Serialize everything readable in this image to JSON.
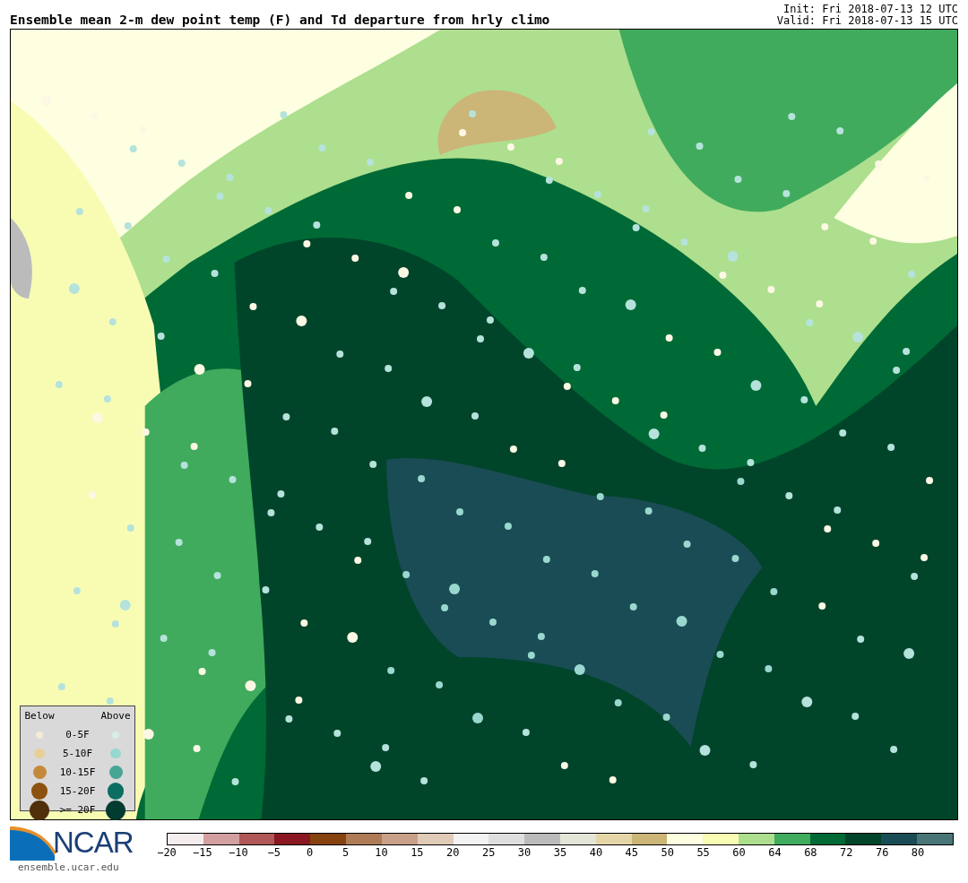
{
  "header": {
    "title": "Ensemble mean 2-m dew point temp (F) and Td departure from hrly climo",
    "init": "Init: Fri 2018-07-13 12 UTC",
    "valid": "Valid: Fri 2018-07-13 15 UTC"
  },
  "legend": {
    "below_heading": "Below",
    "above_heading": "Above",
    "rows": [
      {
        "label": "0-5F",
        "below": {
          "color": "#f3ead8"
        },
        "above": {
          "color": "#d8ecea"
        }
      },
      {
        "label": "5-10F",
        "below": {
          "color": "#e8cf96"
        },
        "above": {
          "color": "#96d8d0"
        }
      },
      {
        "label": "10-15F",
        "below": {
          "color": "#c48a3c"
        },
        "above": {
          "color": "#47a596"
        }
      },
      {
        "label": "15-20F",
        "below": {
          "color": "#8d520f"
        },
        "above": {
          "color": "#0b6e62"
        }
      },
      {
        "label": ">= 20F",
        "below": {
          "color": "#50300a"
        },
        "above": {
          "color": "#023b30"
        }
      }
    ]
  },
  "logo": {
    "name": "NCAR",
    "url": "ensemble.ucar.edu"
  },
  "colorbar": {
    "segments": [
      {
        "color": "#f5eded"
      },
      {
        "color": "#d49fa0"
      },
      {
        "color": "#af5857"
      },
      {
        "color": "#8b1720"
      },
      {
        "color": "#86420f"
      },
      {
        "color": "#ae7b56"
      },
      {
        "color": "#c8a088"
      },
      {
        "color": "#e0cab8"
      },
      {
        "color": "#f2f2f2"
      },
      {
        "color": "#dedede"
      },
      {
        "color": "#bbbbbb"
      },
      {
        "color": "#e3e5d6"
      },
      {
        "color": "#e5d6a8"
      },
      {
        "color": "#cbb577"
      },
      {
        "color": "#fefee0"
      },
      {
        "color": "#f8fcb3"
      },
      {
        "color": "#addf8e"
      },
      {
        "color": "#41ab5d"
      },
      {
        "color": "#006a36"
      },
      {
        "color": "#00452a"
      },
      {
        "color": "#1a4c55"
      },
      {
        "color": "#4a7577"
      }
    ],
    "ticks": [
      "−20",
      "−15",
      "−10",
      "−5",
      "0",
      "5",
      "10",
      "15",
      "20",
      "25",
      "30",
      "35",
      "40",
      "45",
      "50",
      "55",
      "60",
      "64",
      "68",
      "72",
      "76",
      "80"
    ]
  }
}
